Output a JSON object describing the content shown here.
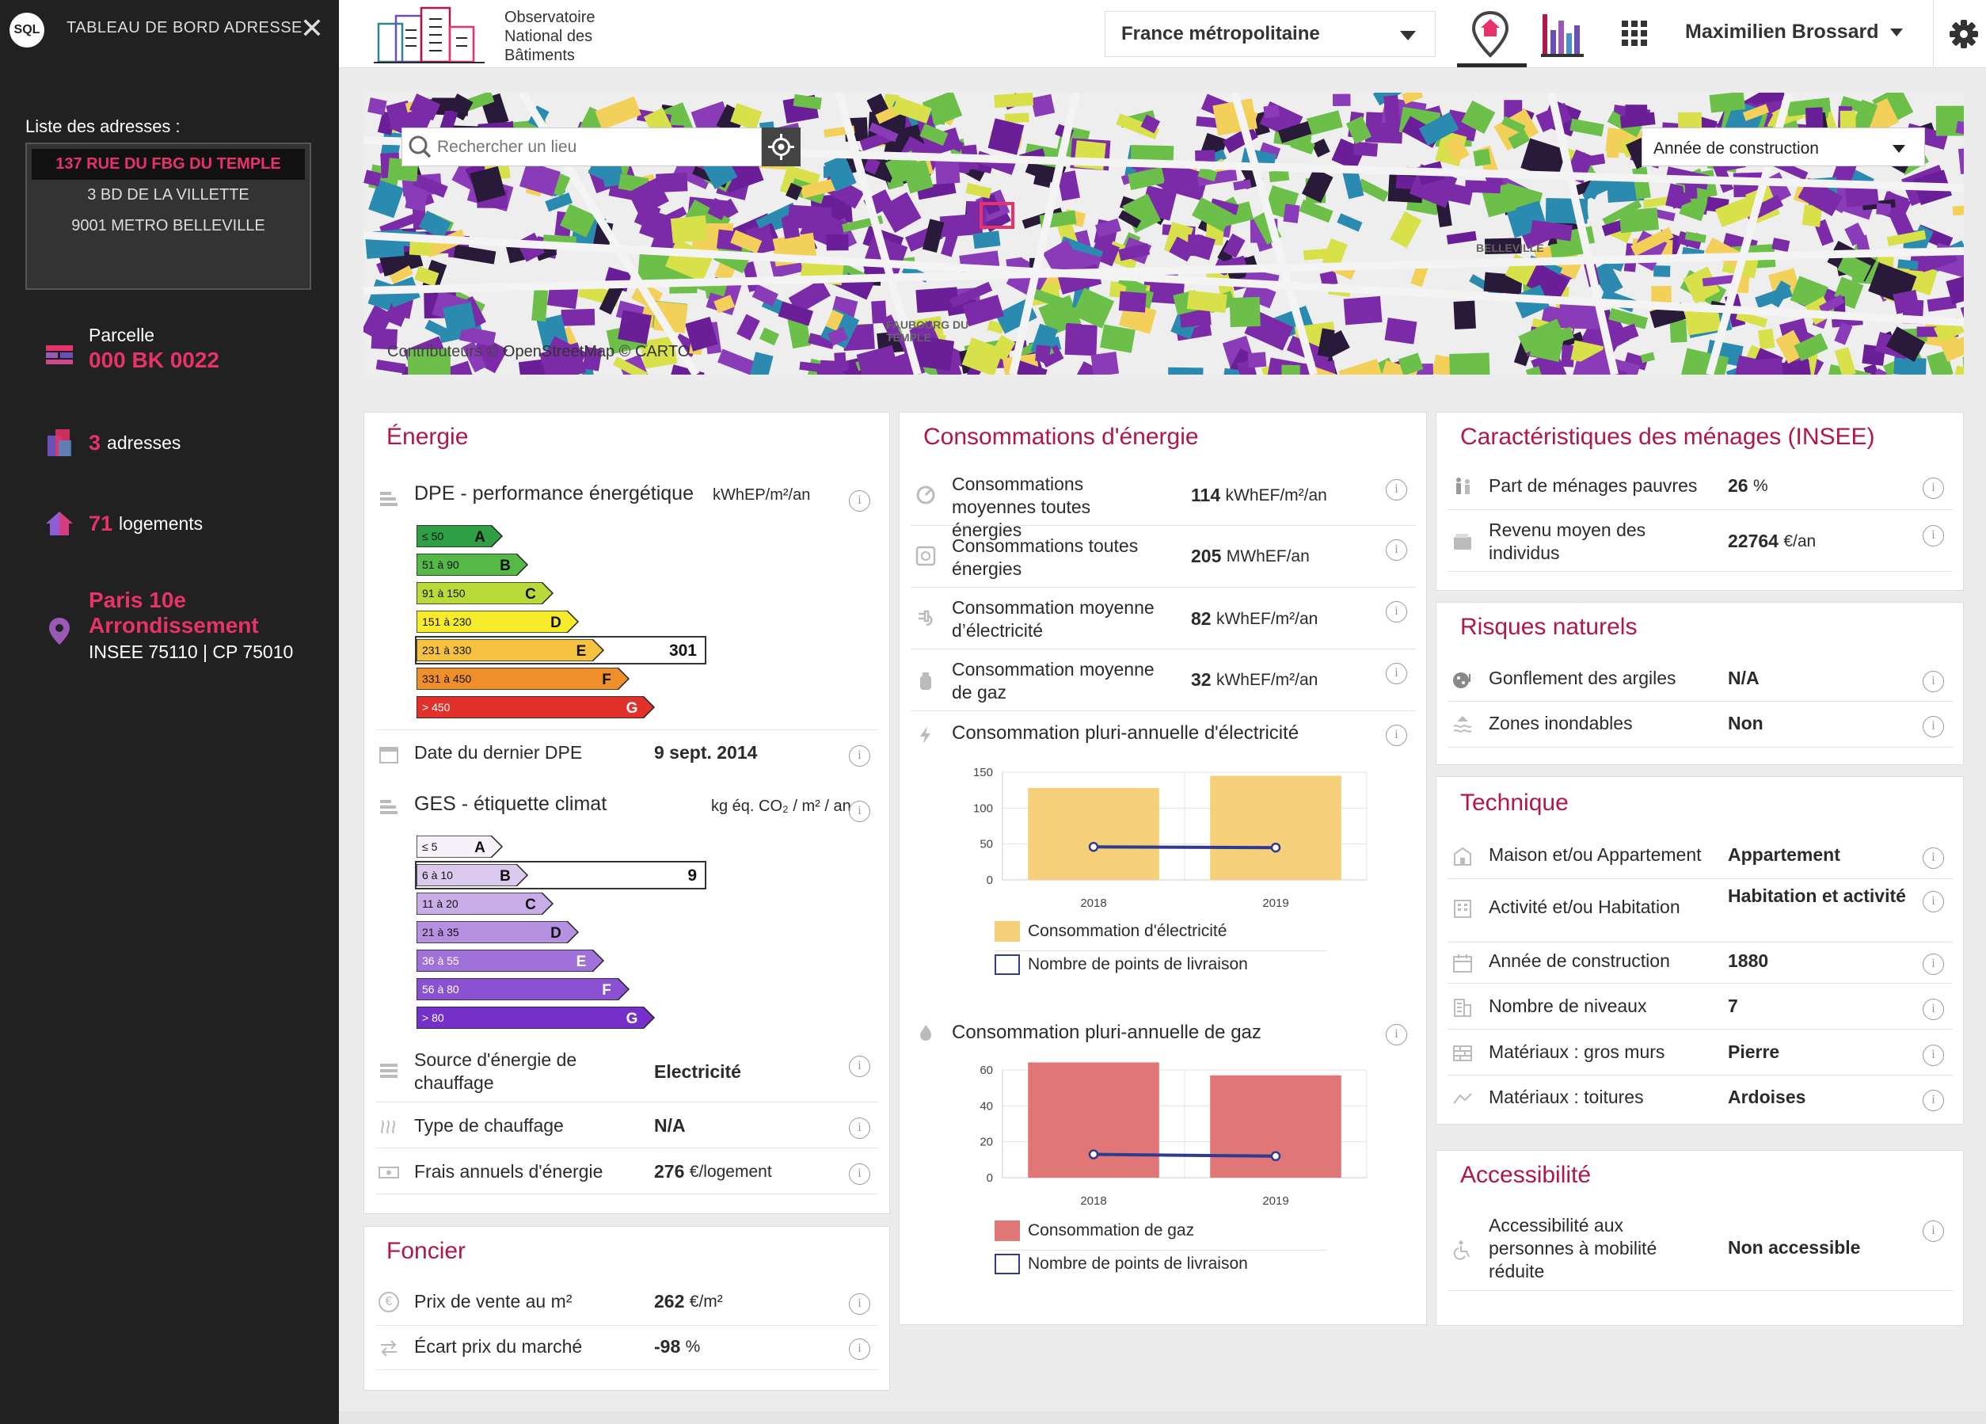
{
  "sidebar": {
    "logo": "SQL",
    "title": "TABLEAU DE BORD ADRESSE",
    "address_list_label": "Liste des adresses :",
    "addresses": [
      {
        "label": "137 RUE DU FBG DU TEMPLE",
        "active": true
      },
      {
        "label": "3 BD DE LA VILLETTE",
        "active": false
      },
      {
        "label": "9001 METRO BELLEVILLE",
        "active": false
      }
    ],
    "parcelle_label": "Parcelle",
    "parcelle_value": "000 BK 0022",
    "adresses_count": "3",
    "adresses_label": "adresses",
    "logements_count": "71",
    "logements_label": "logements",
    "commune_line1": "Paris 10e",
    "commune_line2": "Arrondissement",
    "insee_cp": "INSEE 75110 | CP 75010"
  },
  "topbar": {
    "brand_line1": "Observatoire",
    "brand_line2": "National des",
    "brand_line3": "Bâtiments",
    "region": "France métropolitaine",
    "user": "Maximilien Brossard"
  },
  "map": {
    "search_placeholder": "Rechercher un lieu",
    "layer_select": "Année de construction",
    "credit_prefix": "Contributeurs © ",
    "credit_osm": "OpenStreetMap",
    "credit_mid": " © ",
    "credit_carto": "CARTO",
    "place_labels": [
      "BELLEVILLE",
      "FAUBOURG DU TEMPLE"
    ]
  },
  "energie": {
    "title": "Énergie",
    "dpe_title": "DPE - performance énergétique",
    "dpe_unit": "kWhEP/m²/an",
    "dpe_classes": [
      {
        "range": "≤ 50",
        "letter": "A",
        "color": "#2ea043"
      },
      {
        "range": "51 à 90",
        "letter": "B",
        "color": "#55b948"
      },
      {
        "range": "91 à 150",
        "letter": "C",
        "color": "#b9db3a"
      },
      {
        "range": "151 à 230",
        "letter": "D",
        "color": "#f6ec2c"
      },
      {
        "range": "231 à 330",
        "letter": "E",
        "color": "#f5c240"
      },
      {
        "range": "331 à 450",
        "letter": "F",
        "color": "#ef8f2c"
      },
      {
        "range": "> 450",
        "letter": "G",
        "color": "#e2302a"
      }
    ],
    "dpe_value": "301",
    "dpe_value_class": "E",
    "dpe_date_label": "Date du dernier DPE",
    "dpe_date_value": "9 sept. 2014",
    "ges_title": "GES - étiquette climat",
    "ges_unit": "kg éq. CO₂ / m² / an",
    "ges_classes": [
      {
        "range": "≤ 5",
        "letter": "A",
        "color": "#f7f2fa"
      },
      {
        "range": "6 à 10",
        "letter": "B",
        "color": "#dcc9ee"
      },
      {
        "range": "11 à 20",
        "letter": "C",
        "color": "#c9ade8"
      },
      {
        "range": "21 à 35",
        "letter": "D",
        "color": "#b690e1"
      },
      {
        "range": "36 à 55",
        "letter": "E",
        "color": "#a072d9"
      },
      {
        "range": "56 à 80",
        "letter": "F",
        "color": "#8a52d1"
      },
      {
        "range": "> 80",
        "letter": "G",
        "color": "#7530c9"
      }
    ],
    "ges_value": "9",
    "ges_value_class": "B",
    "source_label": "Source d'énergie de chauffage",
    "source_value": "Electricité",
    "type_label": "Type de chauffage",
    "type_value": "N/A",
    "frais_label": "Frais annuels d'énergie",
    "frais_value": "276",
    "frais_unit": "€/logement"
  },
  "foncier": {
    "title": "Foncier",
    "prix_label": "Prix de vente au m²",
    "prix_value": "262",
    "prix_unit": "€/m²",
    "ecart_label": "Écart prix du marché",
    "ecart_value": "-98",
    "ecart_unit": "%"
  },
  "conso": {
    "title": "Consommations d'énergie",
    "rows": [
      {
        "label": "Consommations moyennes toutes énergies",
        "value": "114",
        "unit": "kWhEF/m²/an"
      },
      {
        "label": "Consommations toutes énergies",
        "value": "205",
        "unit": "MWhEF/an"
      },
      {
        "label": "Consommation moyenne d’électricité",
        "value": "82",
        "unit": "kWhEF/m²/an"
      },
      {
        "label": "Consommation moyenne de gaz",
        "value": "32",
        "unit": "kWhEF/m²/an"
      }
    ],
    "elec_chart_title": "Consommation pluri-annuelle d'électricité",
    "elec_legend_bar": "Consommation d'électricité",
    "elec_legend_line": "Nombre de points de livraison",
    "gaz_chart_title": "Consommation pluri-annuelle de gaz",
    "gaz_legend_bar": "Consommation de gaz",
    "gaz_legend_line": "Nombre de points de livraison"
  },
  "menages": {
    "title": "Caractéristiques des ménages (INSEE)",
    "pauvres_label": "Part de ménages pauvres",
    "pauvres_value": "26",
    "pauvres_unit": "%",
    "revenu_label": "Revenu moyen des individus",
    "revenu_value": "22764",
    "revenu_unit": "€/an"
  },
  "risques": {
    "title": "Risques naturels",
    "argiles_label": "Gonflement des argiles",
    "argiles_value": "N/A",
    "inond_label": "Zones inondables",
    "inond_value": "Non"
  },
  "technique": {
    "title": "Technique",
    "rows": [
      {
        "label": "Maison et/ou Appartement",
        "value": "Appartement"
      },
      {
        "label": "Activité et/ou Habitation",
        "value": "Habitation et activité"
      },
      {
        "label": "Année de construction",
        "value": "1880"
      },
      {
        "label": "Nombre de niveaux",
        "value": "7"
      },
      {
        "label": "Matériaux : gros murs",
        "value": "Pierre"
      },
      {
        "label": "Matériaux : toitures",
        "value": "Ardoises"
      }
    ]
  },
  "accessibilite": {
    "title": "Accessibilité",
    "label": "Accessibilité aux personnes à mobilité réduite",
    "value": "Non accessible"
  },
  "chart_data": [
    {
      "type": "bar",
      "title": "Consommation pluri-annuelle d'électricité",
      "categories": [
        "2018",
        "2019"
      ],
      "ylim": [
        0,
        150
      ],
      "yticks": [
        0,
        50,
        100,
        150
      ],
      "grid": true,
      "legend": "bottom-left",
      "series": [
        {
          "name": "Consommation d'électricité",
          "type": "bar",
          "color": "#f5cf7a",
          "values": [
            128,
            145
          ]
        },
        {
          "name": "Nombre de points de livraison",
          "type": "line",
          "color": "#2f3b8f",
          "values": [
            46,
            45
          ]
        }
      ]
    },
    {
      "type": "bar",
      "title": "Consommation pluri-annuelle de gaz",
      "categories": [
        "2018",
        "2019"
      ],
      "ylim": [
        0,
        60
      ],
      "yticks": [
        0,
        20,
        40,
        60
      ],
      "grid": true,
      "legend": "bottom-left",
      "series": [
        {
          "name": "Consommation de gaz",
          "type": "bar",
          "color": "#e07676",
          "values": [
            66,
            57
          ]
        },
        {
          "name": "Nombre de points de livraison",
          "type": "line",
          "color": "#2f3b8f",
          "values": [
            13,
            12
          ]
        }
      ]
    }
  ]
}
